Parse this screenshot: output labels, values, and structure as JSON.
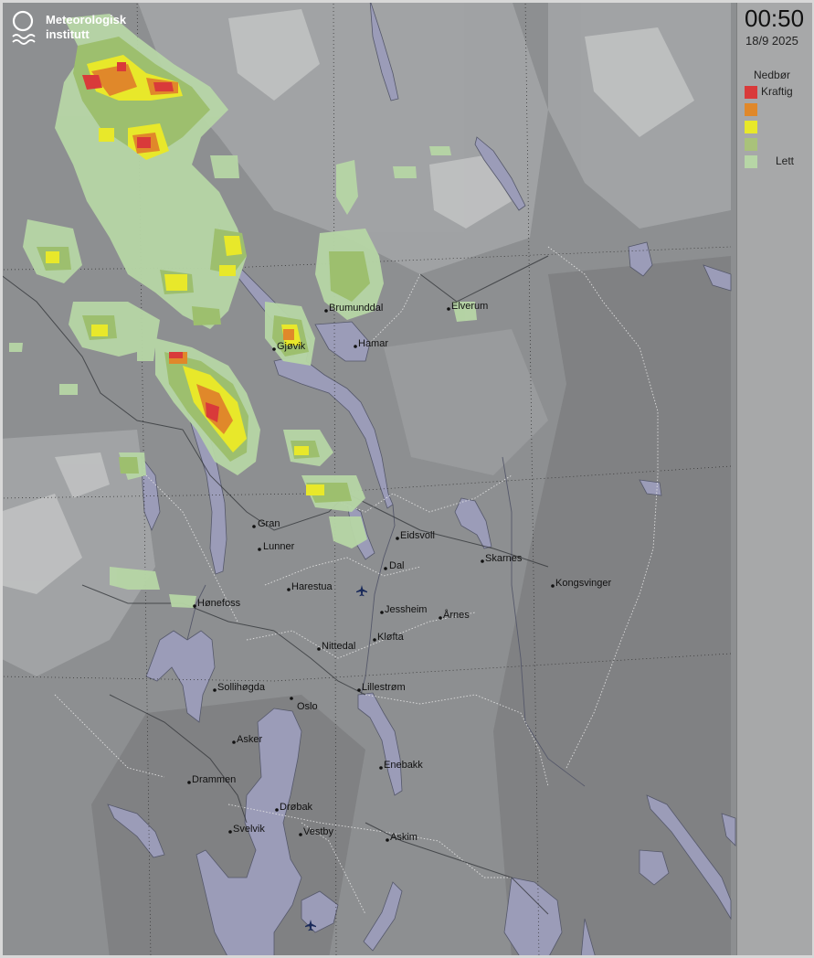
{
  "logo": {
    "line1": "Meteorologisk",
    "line2": "institutt"
  },
  "timestamp": {
    "time": "00:50",
    "date": "18/9 2025"
  },
  "legend": {
    "title": "Nedbør",
    "levels": [
      {
        "label": "Kraftig",
        "color": "#d93a3a"
      },
      {
        "label": "",
        "color": "#e0882a"
      },
      {
        "label": "",
        "color": "#e8e82a"
      },
      {
        "label": "",
        "color": "#a9c27a"
      },
      {
        "label": "Lett",
        "color": "#b7d6a6"
      }
    ]
  },
  "colors": {
    "water": "#9b9cb8",
    "land": "#8d8f91",
    "panel": "#a7a8a9"
  },
  "places": [
    {
      "name": "Brumunddal",
      "key": "brumunddal"
    },
    {
      "name": "Elverum",
      "key": "elverum"
    },
    {
      "name": "Gjøvik",
      "key": "gjovik"
    },
    {
      "name": "Hamar",
      "key": "hamar"
    },
    {
      "name": "Gran",
      "key": "gran"
    },
    {
      "name": "Lunner",
      "key": "lunner"
    },
    {
      "name": "Eidsvoll",
      "key": "eidsvoll"
    },
    {
      "name": "Dal",
      "key": "dal"
    },
    {
      "name": "Skarnes",
      "key": "skarnes"
    },
    {
      "name": "Kongsvinger",
      "key": "kongsvinger"
    },
    {
      "name": "Harestua",
      "key": "harestua"
    },
    {
      "name": "Hønefoss",
      "key": "honefoss"
    },
    {
      "name": "Jessheim",
      "key": "jessheim"
    },
    {
      "name": "Årnes",
      "key": "arnes"
    },
    {
      "name": "Kløfta",
      "key": "klofta"
    },
    {
      "name": "Nittedal",
      "key": "nittedal"
    },
    {
      "name": "Sollihøgda",
      "key": "sollihogda"
    },
    {
      "name": "Lillestrøm",
      "key": "lillestrom"
    },
    {
      "name": "Oslo",
      "key": "oslo"
    },
    {
      "name": "Asker",
      "key": "asker"
    },
    {
      "name": "Enebakk",
      "key": "enebakk"
    },
    {
      "name": "Drammen",
      "key": "drammen"
    },
    {
      "name": "Drøbak",
      "key": "drobak"
    },
    {
      "name": "Svelvik",
      "key": "svelvik"
    },
    {
      "name": "Vestby",
      "key": "vestby"
    },
    {
      "name": "Askim",
      "key": "askim"
    }
  ],
  "airports": [
    {
      "icon": "airplane-icon",
      "key": "gardermoen"
    },
    {
      "icon": "airplane-icon",
      "key": "rygge"
    }
  ]
}
